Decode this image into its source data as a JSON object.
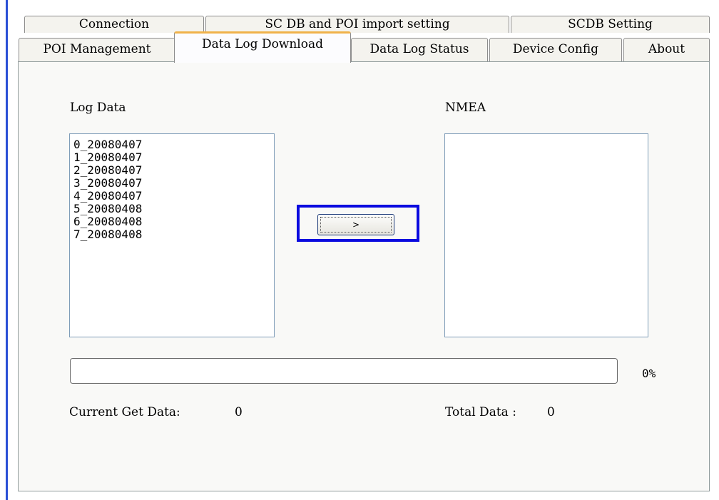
{
  "tabs": {
    "row1": [
      "Connection",
      "SC DB and POI import setting",
      "SCDB  Setting"
    ],
    "row2": [
      "POI Management",
      "Data Log Download",
      "Data Log Status",
      "Device Config",
      "About"
    ]
  },
  "active_tab": "Data Log Download",
  "log_data": {
    "label": "Log Data",
    "items": [
      "0_20080407",
      "1_20080407",
      "2_20080407",
      "3_20080407",
      "4_20080407",
      "5_20080408",
      "6_20080408",
      "7_20080408"
    ]
  },
  "nmea": {
    "label": "NMEA",
    "items": []
  },
  "transfer_button": {
    "label": ">"
  },
  "progress": {
    "value": 0,
    "text": "0%"
  },
  "current_get_data": {
    "label": "Current Get Data:",
    "value": "0"
  },
  "total_data": {
    "label": "Total Data :",
    "value": "0"
  },
  "colors": {
    "highlight": "#0a0adf",
    "active_tab_accent": "#f0b24a",
    "app_edge": "#2a50d6"
  }
}
